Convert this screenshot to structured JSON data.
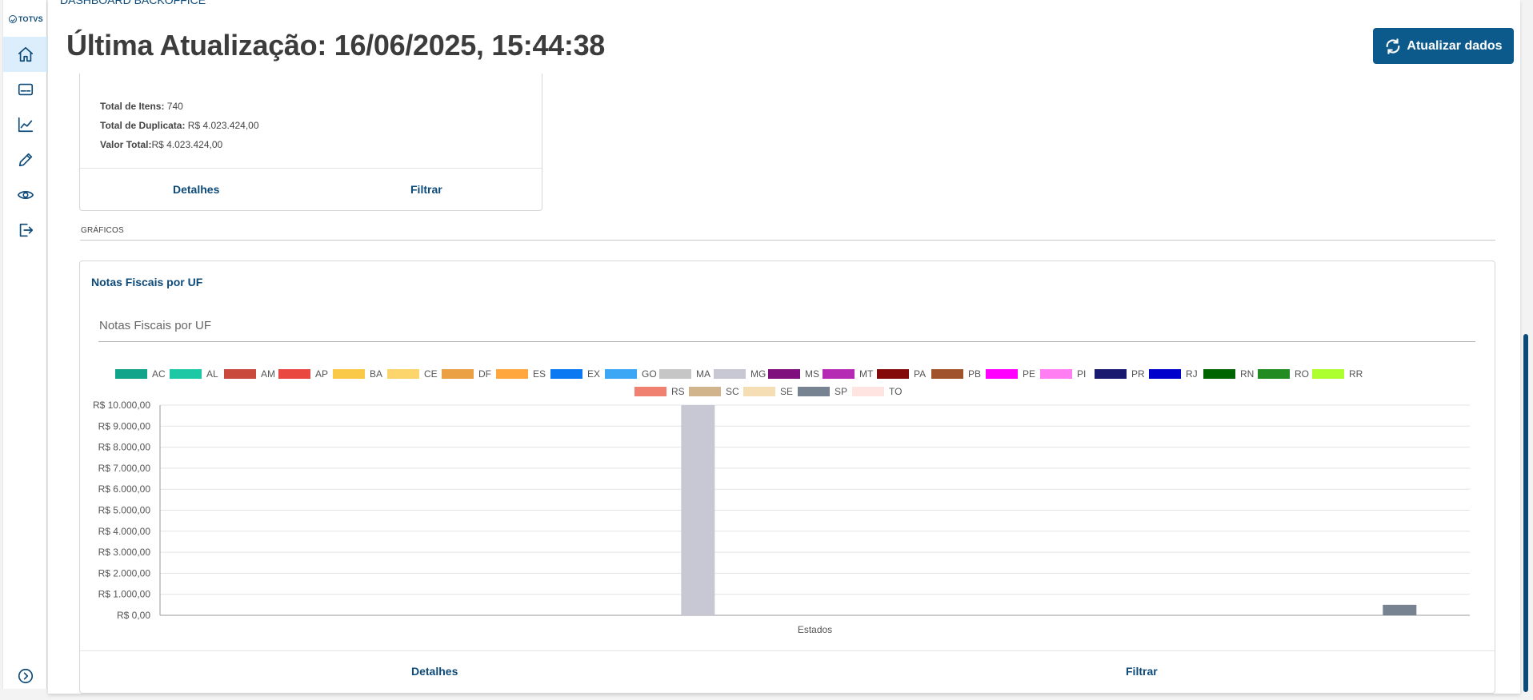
{
  "app": {
    "logo_text": "TOTVS",
    "breadcrumb": "DASHBOARD BACKOFFICE"
  },
  "sidebar": {
    "items": [
      {
        "name": "home",
        "icon": "home-icon",
        "active": true
      },
      {
        "name": "card",
        "icon": "card-icon",
        "active": false
      },
      {
        "name": "chart",
        "icon": "chart-line-icon",
        "active": false
      },
      {
        "name": "edit",
        "icon": "pencil-icon",
        "active": false
      },
      {
        "name": "view",
        "icon": "eye-icon",
        "active": false
      },
      {
        "name": "logout",
        "icon": "logout-icon",
        "active": false
      }
    ],
    "expand_icon": "chevron-right-circle-icon"
  },
  "header": {
    "title": "Última Atualização: 16/06/2025, 15:44:38",
    "refresh_label": "Atualizar dados"
  },
  "summary_card": {
    "lines": [
      {
        "label": "Total de Itens:",
        "value": " 740"
      },
      {
        "label": "Total de Duplicata:",
        "value": " R$ 4.023.424,00"
      },
      {
        "label": "Valor Total:",
        "value": "R$ 4.023.424,00"
      }
    ],
    "details_label": "Detalhes",
    "filter_label": "Filtrar"
  },
  "section": {
    "label": "GRÁFICOS"
  },
  "chart_card": {
    "title": "Notas Fiscais por UF",
    "details_label": "Detalhes",
    "filter_label": "Filtrar"
  },
  "colors": {
    "primary": "#0c4a7a",
    "button": "#0c5a8c"
  },
  "chart_data": {
    "type": "bar",
    "title": "Notas Fiscais por UF",
    "xlabel": "Estados",
    "ylabel": "",
    "ylim": [
      0,
      10000
    ],
    "yticks": [
      "R$ 0,00",
      "R$ 1.000,00",
      "R$ 2.000,00",
      "R$ 3.000,00",
      "R$ 4.000,00",
      "R$ 5.000,00",
      "R$ 6.000,00",
      "R$ 7.000,00",
      "R$ 8.000,00",
      "R$ 9.000,00",
      "R$ 10.000,00"
    ],
    "grid": true,
    "legend_position": "top",
    "series": [
      {
        "name": "AC",
        "color": "#12a48a",
        "value": 0
      },
      {
        "name": "AL",
        "color": "#1ec8a5",
        "value": 0
      },
      {
        "name": "AM",
        "color": "#c9493c",
        "value": 0
      },
      {
        "name": "AP",
        "color": "#e8483f",
        "value": 0
      },
      {
        "name": "BA",
        "color": "#fbc948",
        "value": 0
      },
      {
        "name": "CE",
        "color": "#fcd56c",
        "value": 0
      },
      {
        "name": "DF",
        "color": "#eba045",
        "value": 0
      },
      {
        "name": "ES",
        "color": "#ffa73c",
        "value": 0
      },
      {
        "name": "EX",
        "color": "#0b7af2",
        "value": 0
      },
      {
        "name": "GO",
        "color": "#3ba7f5",
        "value": 0
      },
      {
        "name": "MA",
        "color": "#c6c6c6",
        "value": 0
      },
      {
        "name": "MG",
        "color": "#c7c8d4",
        "value": 10000
      },
      {
        "name": "MS",
        "color": "#800f7e",
        "value": 0
      },
      {
        "name": "MT",
        "color": "#b52bb3",
        "value": 0
      },
      {
        "name": "PA",
        "color": "#840a0a",
        "value": 0
      },
      {
        "name": "PB",
        "color": "#a0522d",
        "value": 0
      },
      {
        "name": "PE",
        "color": "#ff00ff",
        "value": 0
      },
      {
        "name": "PI",
        "color": "#ff7ef2",
        "value": 0
      },
      {
        "name": "PR",
        "color": "#191970",
        "value": 0
      },
      {
        "name": "RJ",
        "color": "#0000cd",
        "value": 0
      },
      {
        "name": "RN",
        "color": "#006400",
        "value": 0
      },
      {
        "name": "RO",
        "color": "#228b22",
        "value": 0
      },
      {
        "name": "RR",
        "color": "#adff2f",
        "value": 0
      },
      {
        "name": "RS",
        "color": "#f08070",
        "value": 0
      },
      {
        "name": "SC",
        "color": "#d2b48c",
        "value": 0
      },
      {
        "name": "SE",
        "color": "#f5deb3",
        "value": 0
      },
      {
        "name": "SP",
        "color": "#778391",
        "value": 500
      },
      {
        "name": "TO",
        "color": "#ffe4e1",
        "value": 0
      }
    ]
  }
}
